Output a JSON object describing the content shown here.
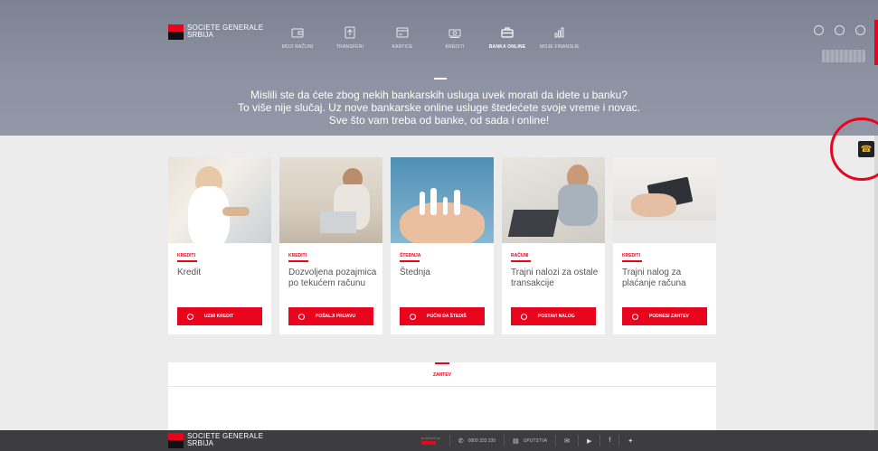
{
  "brand": {
    "line1": "SOCIETE GENERALE",
    "line2": "SRBIJA",
    "colors": {
      "red": "#e9041e",
      "black": "#111111"
    }
  },
  "nav": [
    {
      "label": "MOJI RAČUNI",
      "icon": "wallet-icon"
    },
    {
      "label": "TRANSFERI",
      "icon": "transfer-icon"
    },
    {
      "label": "KARTICE",
      "icon": "card-icon"
    },
    {
      "label": "KREDITI",
      "icon": "money-icon"
    },
    {
      "label": "BANKA ONLINE",
      "icon": "briefcase-icon",
      "active": true
    },
    {
      "label": "MOJE FINANSIJE",
      "icon": "bar-chart-icon"
    }
  ],
  "top_icons": [
    "settings-icon",
    "chat-icon",
    "logout-icon"
  ],
  "hero": {
    "line1": "Mislili ste da ćete zbog nekih bankarskih usluga uvek morati da idete u banku?",
    "line2": "To više nije slučaj. Uz nove bankarske online usluge štedećete svoje vreme i novac.",
    "line3": "Sve što vam treba od banke, od sada i online!"
  },
  "cards": [
    {
      "category": "KREDITI",
      "title": "Kredit",
      "button": "UZMI KREDIT"
    },
    {
      "category": "KREDITI",
      "title": "Dozvoljena pozajmica po tekućem računu",
      "button": "POŠALJI PRIJAVU"
    },
    {
      "category": "ŠTEDNJA",
      "title": "Štednja",
      "button": "POČNI DA ŠTEDIŠ"
    },
    {
      "category": "RAČUNI",
      "title": "Trajni nalozi za ostale transakcije",
      "button": "POSTAVI NALOG"
    },
    {
      "category": "KREDITI",
      "title": "Trajni nalog za plaćanje računa",
      "button": "PODNESI ZAHTEV"
    }
  ],
  "request": {
    "label": "ZAHTEV"
  },
  "footer": {
    "powered": "powered by",
    "phone": "0800 333 330",
    "guide": "UPUTSTVA",
    "icons": [
      "mail-icon",
      "youtube-icon",
      "facebook-icon",
      "twitter-icon"
    ]
  }
}
